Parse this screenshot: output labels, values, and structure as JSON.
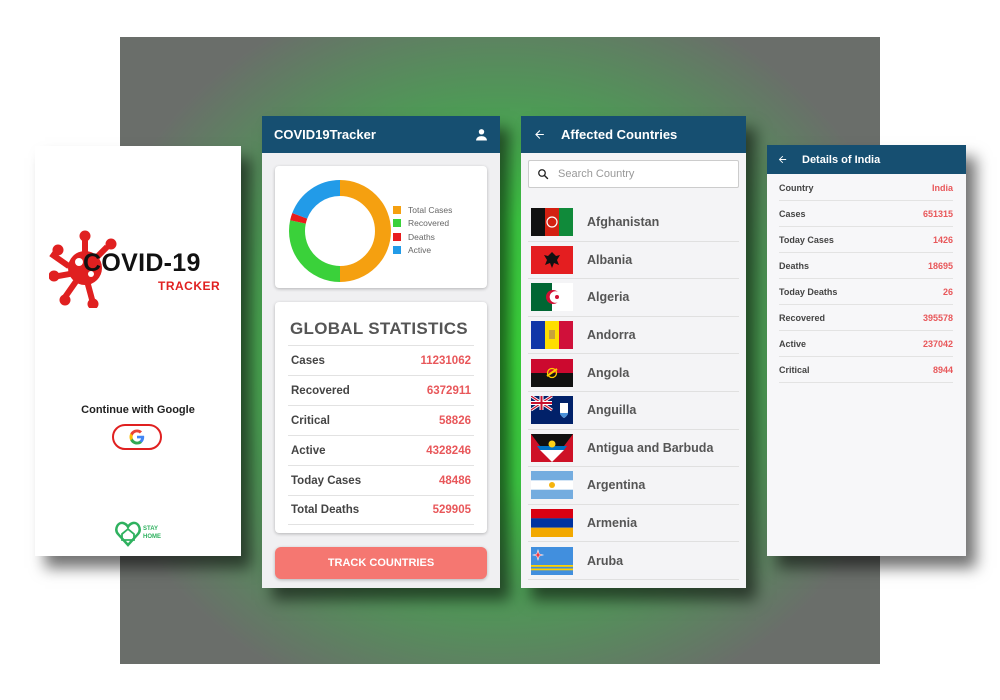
{
  "login": {
    "logo_title": "COVID-19",
    "logo_subtitle": "TRACKER",
    "continue_text": "Continue with Google",
    "google_icon": "google-g-icon",
    "footer_icon": "stay-home-heart-icon",
    "footer_text_line1": "STAY",
    "footer_text_line2": "HOME",
    "colors": {
      "red": "#e02020",
      "green": "#2fb15f"
    }
  },
  "dashboard": {
    "app_title": "COVID19Tracker",
    "profile_icon": "person-icon",
    "chart_data": {
      "type": "pie",
      "categories": [
        "Total Cases",
        "Recovered",
        "Deaths",
        "Active"
      ],
      "values": [
        11231062,
        6372911,
        529905,
        4328246
      ],
      "colors": [
        "#f5a010",
        "#3ad13a",
        "#e81c1c",
        "#229be8"
      ],
      "legend_placement": "right"
    },
    "legend": [
      "Total Cases",
      "Recovered",
      "Deaths",
      "Active"
    ],
    "stats_title": "GLOBAL STATISTICS",
    "stats": [
      {
        "label": "Cases",
        "value": "11231062"
      },
      {
        "label": "Recovered",
        "value": "6372911"
      },
      {
        "label": "Critical",
        "value": "58826"
      },
      {
        "label": "Active",
        "value": "4328246"
      },
      {
        "label": "Today Cases",
        "value": "48486"
      },
      {
        "label": "Total Deaths",
        "value": "529905"
      }
    ],
    "track_button": "TRACK COUNTRIES",
    "colors": {
      "appbar": "#164f71",
      "value": "#e8575a",
      "button": "#f57771"
    }
  },
  "countries": {
    "title": "Affected Countries",
    "back_icon": "arrow-left-icon",
    "search_icon": "magnifier-icon",
    "search_placeholder": "Search Country",
    "items": [
      {
        "name": "Afghanistan"
      },
      {
        "name": "Albania"
      },
      {
        "name": "Algeria"
      },
      {
        "name": "Andorra"
      },
      {
        "name": "Angola"
      },
      {
        "name": "Anguilla"
      },
      {
        "name": "Antigua and Barbuda"
      },
      {
        "name": "Argentina"
      },
      {
        "name": "Armenia"
      },
      {
        "name": "Aruba"
      }
    ]
  },
  "details": {
    "title": "Details of India",
    "back_icon": "arrow-left-icon",
    "rows": [
      {
        "label": "Country",
        "value": "India"
      },
      {
        "label": "Cases",
        "value": "651315"
      },
      {
        "label": "Today Cases",
        "value": "1426"
      },
      {
        "label": "Deaths",
        "value": "18695"
      },
      {
        "label": "Today Deaths",
        "value": "26"
      },
      {
        "label": "Recovered",
        "value": "395578"
      },
      {
        "label": "Active",
        "value": "237042"
      },
      {
        "label": "Critical",
        "value": "8944"
      }
    ]
  }
}
